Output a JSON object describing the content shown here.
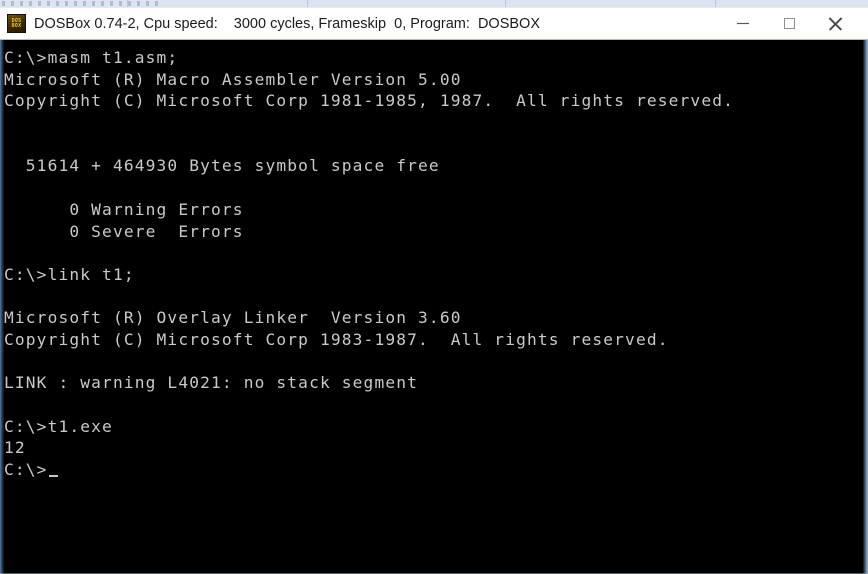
{
  "window": {
    "title_left": "DOSBox 0.74-2, Cpu speed:",
    "title_right": "3000 cycles, Frameskip  0, Program:  DOSBOX",
    "icon_name": "dosbox-icon",
    "icon_line1": "DOS",
    "icon_line2": "BOX",
    "controls": {
      "minimize_label": "—",
      "maximize_label": "□",
      "close_label": "✕"
    },
    "colors": {
      "titlebar_bg": "#ffffff",
      "titlebar_text": "#1b1b1b",
      "console_bg": "#000000",
      "console_text": "#c9c9c9",
      "border_edge": "#aebdd2",
      "icon_gold": "#f0c419"
    }
  },
  "console": {
    "prompt": "C:\\>",
    "cursor_char": "_",
    "lines": [
      "C:\\>masm t1.asm;",
      "Microsoft (R) Macro Assembler Version 5.00",
      "Copyright (C) Microsoft Corp 1981-1985, 1987.  All rights reserved.",
      "",
      "",
      "  51614 + 464930 Bytes symbol space free",
      "",
      "      0 Warning Errors",
      "      0 Severe  Errors",
      "",
      "C:\\>link t1;",
      "",
      "Microsoft (R) Overlay Linker  Version 3.60",
      "Copyright (C) Microsoft Corp 1983-1987.  All rights reserved.",
      "",
      "LINK : warning L4021: no stack segment",
      "",
      "C:\\>t1.exe",
      "12",
      "C:\\>"
    ],
    "commands": [
      "masm t1.asm;",
      "link t1;",
      "t1.exe"
    ],
    "program_output": "12",
    "assembler": {
      "name": "Microsoft (R) Macro Assembler",
      "version": "5.00",
      "copyright": "Copyright (C) Microsoft Corp 1981-1985, 1987.  All rights reserved.",
      "symbol_space_free": "51614 + 464930 Bytes symbol space free",
      "warning_errors": "0 Warning Errors",
      "severe_errors": "0 Severe  Errors"
    },
    "linker": {
      "name": "Microsoft (R) Overlay Linker",
      "version": "3.60",
      "copyright": "Copyright (C) Microsoft Corp 1983-1987.  All rights reserved.",
      "warning": "LINK : warning L4021: no stack segment"
    }
  }
}
